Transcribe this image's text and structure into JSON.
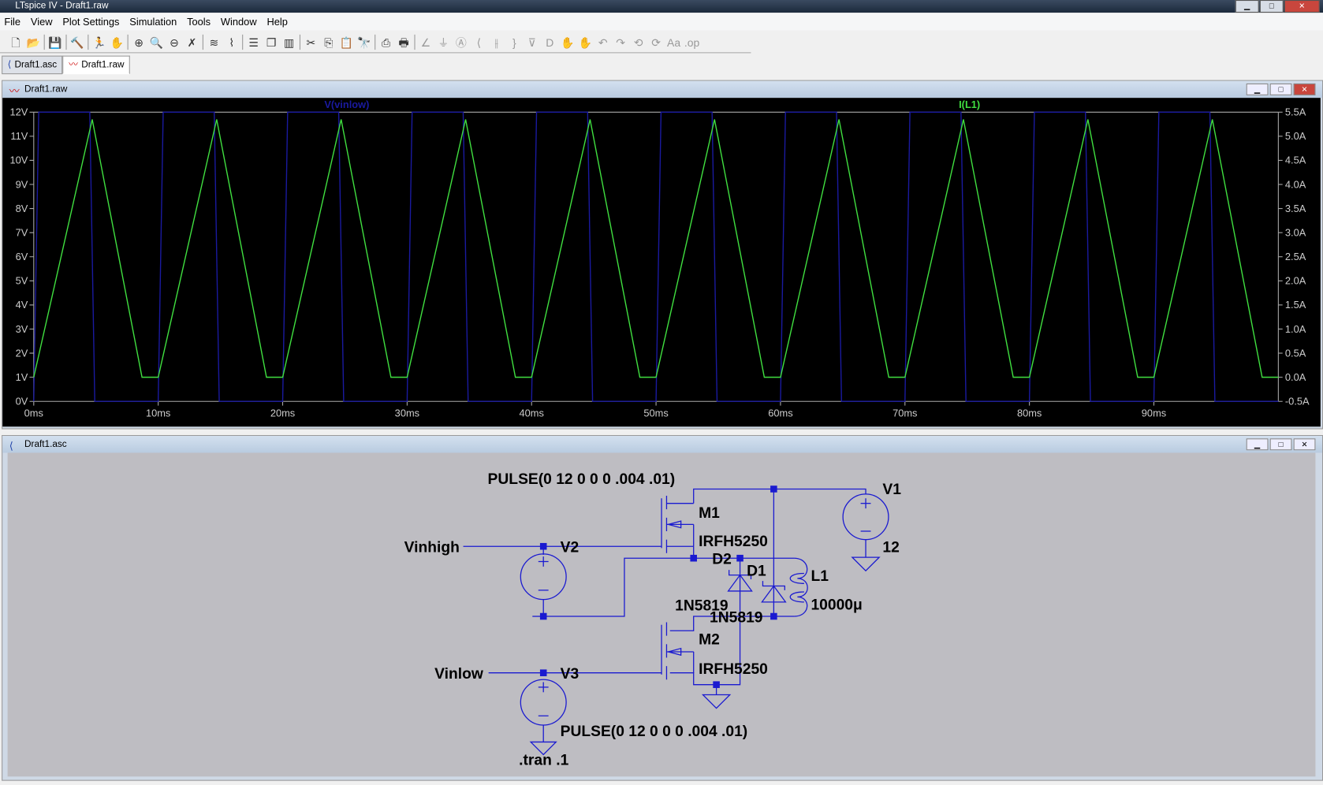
{
  "window": {
    "title": "LTspice IV - Draft1.raw",
    "controls": [
      "minimize",
      "maximize",
      "close"
    ]
  },
  "menu": [
    "File",
    "View",
    "Plot Settings",
    "Simulation",
    "Tools",
    "Window",
    "Help"
  ],
  "toolbar": [
    "new-schematic",
    "open",
    "save",
    "control-panel",
    "run",
    "halt",
    "zoom-in",
    "pan",
    "zoom-out",
    "zoom-fit",
    "autorange",
    "add-trace",
    "tile-horizontal",
    "cascade",
    "tile-vertical",
    "cut",
    "copy",
    "paste",
    "find",
    "print-setup",
    "print",
    "wire",
    "ground",
    "label-net",
    "resistor",
    "capacitor",
    "inductor",
    "diode",
    "component",
    "move",
    "drag",
    "undo",
    "redo",
    "rotate",
    "mirror",
    "text",
    "spice-directive"
  ],
  "tabs": [
    {
      "label": "Draft1.asc",
      "icon": "schematic-icon",
      "active": false
    },
    {
      "label": "Draft1.raw",
      "icon": "waveform-icon",
      "active": true
    }
  ],
  "plot_window": {
    "title": "Draft1.raw"
  },
  "schematic_window": {
    "title": "Draft1.asc"
  },
  "chart_data": {
    "type": "line",
    "background": "#000000",
    "x_ticks": [
      "0ms",
      "10ms",
      "20ms",
      "30ms",
      "40ms",
      "50ms",
      "60ms",
      "70ms",
      "80ms",
      "90ms"
    ],
    "xlim": [
      0,
      100
    ],
    "x_unit": "ms",
    "y_left_ticks": [
      "0V",
      "1V",
      "2V",
      "3V",
      "4V",
      "5V",
      "6V",
      "7V",
      "8V",
      "9V",
      "10V",
      "11V",
      "12V"
    ],
    "ylim_left": [
      0,
      12
    ],
    "y_right_ticks": [
      "-0.5A",
      "0.0A",
      "0.5A",
      "1.0A",
      "1.5A",
      "2.0A",
      "2.5A",
      "3.0A",
      "3.5A",
      "4.0A",
      "4.5A",
      "5.0A",
      "5.5A"
    ],
    "ylim_right": [
      -0.5,
      5.5
    ],
    "series": [
      {
        "name": "V(vinlow)",
        "color": "#1a1aa0",
        "axis": "left",
        "period_ms": 10,
        "points": [
          [
            0,
            0
          ],
          [
            0.4,
            12
          ],
          [
            4.5,
            12
          ],
          [
            4.9,
            0
          ],
          [
            10,
            0
          ]
        ]
      },
      {
        "name": "I(L1)",
        "color": "#40e040",
        "axis": "right",
        "period_ms": 10,
        "points": [
          [
            0,
            0
          ],
          [
            4.7,
            5.35
          ],
          [
            8.7,
            0
          ],
          [
            10,
            0
          ]
        ]
      }
    ]
  },
  "schematic": {
    "v2_value": "PULSE(0 12 0 0 0 .004 .01)",
    "v3_value": "PULSE(0 12 0 0 0 .004 .01)",
    "vinhigh": "Vinhigh",
    "vinlow": "Vinlow",
    "v2": "V2",
    "v3": "V3",
    "v1": "V1",
    "v1_value": "12",
    "m1": "M1",
    "m1_model": "IRFH5250",
    "m2": "M2",
    "m2_model": "IRFH5250",
    "d1": "D1",
    "d1_model": "1N5819",
    "d2": "D2",
    "d2_model": "1N5819",
    "l1": "L1",
    "l1_value": "10000μ",
    "directive": ".tran .1",
    "wire_color": "#1a1ad0"
  }
}
